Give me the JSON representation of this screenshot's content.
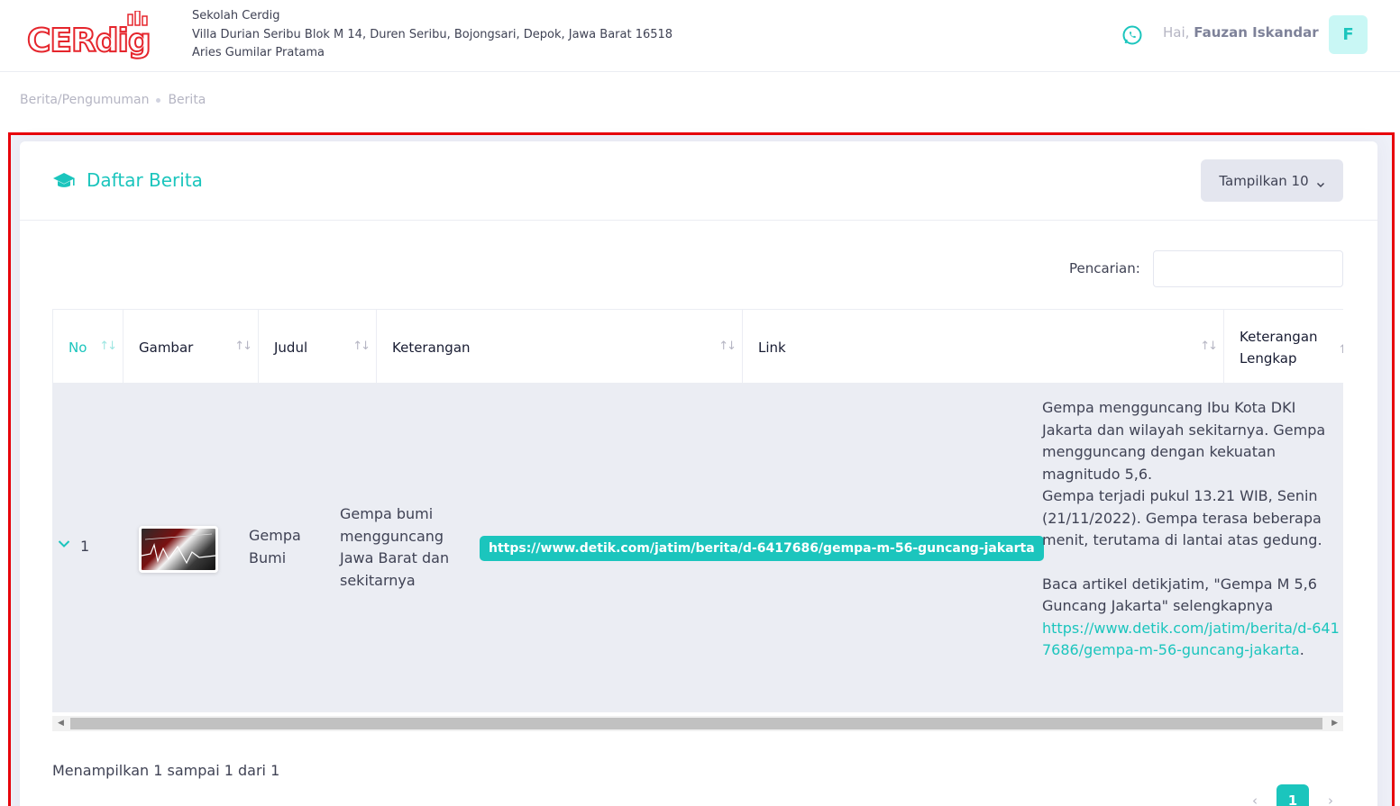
{
  "header": {
    "logo_text": "CERdig",
    "school_name": "Sekolah Cerdig",
    "school_address": "Villa Durian Seribu Blok M 14, Duren Seribu, Bojongsari, Depok, Jawa Barat 16518",
    "school_person": "Aries Gumilar Pratama",
    "greeting": "Hai,",
    "user_name": "Fauzan Iskandar",
    "avatar_initial": "F"
  },
  "breadcrumb": [
    "Berita/Pengumuman",
    "Berita"
  ],
  "card": {
    "title": "Daftar Berita",
    "show_button": "Tampilkan 10",
    "search_label": "Pencarian:",
    "search_value": ""
  },
  "table": {
    "columns": [
      "No",
      "Gambar",
      "Judul",
      "Keterangan",
      "Link",
      "Keterangan Lengkap"
    ],
    "rows": [
      {
        "no": "1",
        "judul": "Gempa Bumi",
        "keterangan": "Gempa bumi mengguncang Jawa Barat dan sekitarnya",
        "link": "https://www.detik.com/jatim/berita/d-6417686/gempa-m-56-guncang-jakarta",
        "full_p1": "Gempa mengguncang Ibu Kota DKI Jakarta dan wilayah sekitarnya. Gempa mengguncang dengan kekuatan magnitudo 5,6.",
        "full_p2": "Gempa terjadi pukul 13.21 WIB, Senin (21/11/2022). Gempa terasa beberapa menit, terutama di lantai atas gedung.",
        "full_p3": "Baca artikel detikjatim, \"Gempa M 5,6 Guncang Jakarta\" selengkapnya",
        "full_link": "https://www.detik.com/jatim/berita/d-6417686/gempa-m-56-guncang-jakarta",
        "full_end": "."
      }
    ]
  },
  "footer": {
    "info": "Menampilkan 1 sampai 1 dari 1",
    "prev": "‹",
    "current_page": "1",
    "next": "›"
  },
  "colors": {
    "accent": "#1bc5bd",
    "highlight_border": "#e8000b",
    "logo_red": "#e5252c"
  }
}
